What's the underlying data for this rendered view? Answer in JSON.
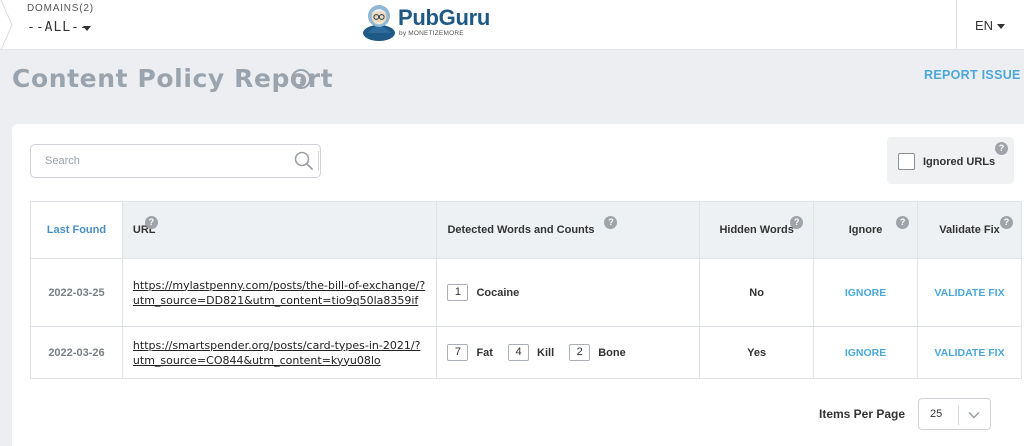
{
  "header": {
    "domains_label": "DOMAINS(2)",
    "domains_value": "--ALL--",
    "brand": "PubGuru",
    "brand_sub": "by MONETIZEMORE",
    "lang": "EN"
  },
  "page": {
    "title": "Content Policy Report",
    "report_issue": "REPORT ISSUE"
  },
  "filters": {
    "search_placeholder": "Search",
    "ignored_urls_label": "Ignored URLs"
  },
  "table": {
    "columns": [
      "Last Found",
      "URL",
      "Detected Words and Counts",
      "Hidden Words",
      "Ignore",
      "Validate Fix"
    ],
    "rows": [
      {
        "last_found": "2022-03-25",
        "url": "https://mylastpenny.com/posts/the-bill-of-exchange/?utm_source=DD821&utm_content=tio9q50la8359if",
        "words": [
          {
            "count": "1",
            "word": "Cocaine"
          }
        ],
        "hidden": "No",
        "ignore": "IGNORE",
        "validate": "VALIDATE FIX"
      },
      {
        "last_found": "2022-03-26",
        "url": "https://smartspender.org/posts/card-types-in-2021/?utm_source=CO844&utm_content=kyyu08lo",
        "words": [
          {
            "count": "7",
            "word": "Fat"
          },
          {
            "count": "4",
            "word": "Kill"
          },
          {
            "count": "2",
            "word": "Bone"
          }
        ],
        "hidden": "Yes",
        "ignore": "IGNORE",
        "validate": "VALIDATE FIX"
      }
    ]
  },
  "footer": {
    "items_per_page_label": "Items Per Page",
    "items_per_page_value": "25"
  },
  "icons": {
    "help": "question-circle-icon",
    "search": "search-icon",
    "caret": "caret-down-icon",
    "chevron": "chevron-down-icon"
  },
  "colors": {
    "accent": "#4aa8dc",
    "brand": "#1f5a86",
    "title": "#9aa4ae",
    "background": "#edeef1"
  }
}
